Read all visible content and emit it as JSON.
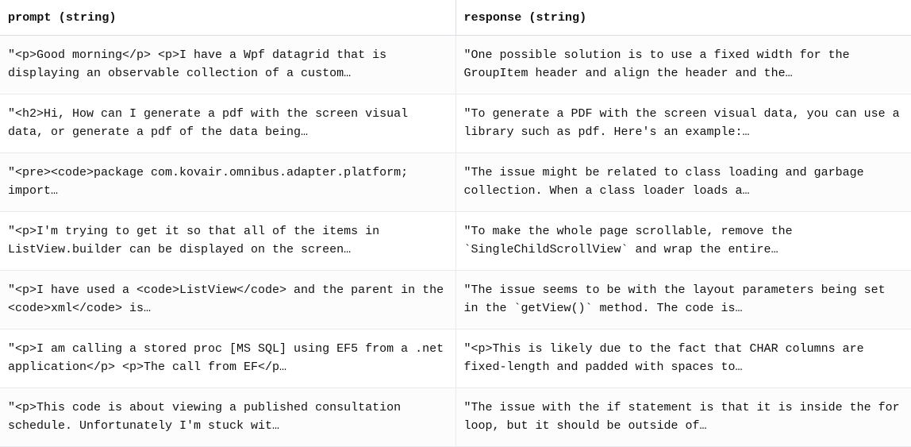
{
  "columns": [
    {
      "name": "prompt",
      "type": "string"
    },
    {
      "name": "response",
      "type": "string"
    }
  ],
  "rows": [
    {
      "prompt": "\"<p>Good morning</p> <p>I have a Wpf datagrid that is displaying an observable collection of a custom…",
      "response": "\"One possible solution is to use a fixed width for the GroupItem header and align the header and the…"
    },
    {
      "prompt": "\"<h2>Hi, How can I generate a pdf with the screen visual data, or generate a pdf of the data being…",
      "response": "\"To generate a PDF with the screen visual data, you can use a library such as pdf. Here's an example:…"
    },
    {
      "prompt": "\"<pre><code>package com.kovair.omnibus.adapter.platform; import…",
      "response": "\"The issue might be related to class loading and garbage collection. When a class loader loads a…"
    },
    {
      "prompt": "\"<p>I'm trying to get it so that all of the items in ListView.builder can be displayed on the screen…",
      "response": "\"To make the whole page scrollable, remove the `SingleChildScrollView` and wrap the entire…"
    },
    {
      "prompt": "\"<p>I have used a <code>ListView</code> and the parent in the <code>xml</code> is…",
      "response": "\"The issue seems to be with the layout parameters being set in the `getView()` method. The code is…"
    },
    {
      "prompt": "\"<p>I am calling a stored proc [MS SQL] using EF5 from a .net application</p> <p>The call from EF</p…",
      "response": "\"<p>This is likely due to the fact that CHAR columns are fixed-length and padded with spaces to…"
    },
    {
      "prompt": "\"<p>This code is about viewing a published consultation schedule. Unfortunately I'm stuck wit…",
      "response": "\"The issue with the if statement is that it is inside the for loop, but it should be outside of…"
    }
  ]
}
